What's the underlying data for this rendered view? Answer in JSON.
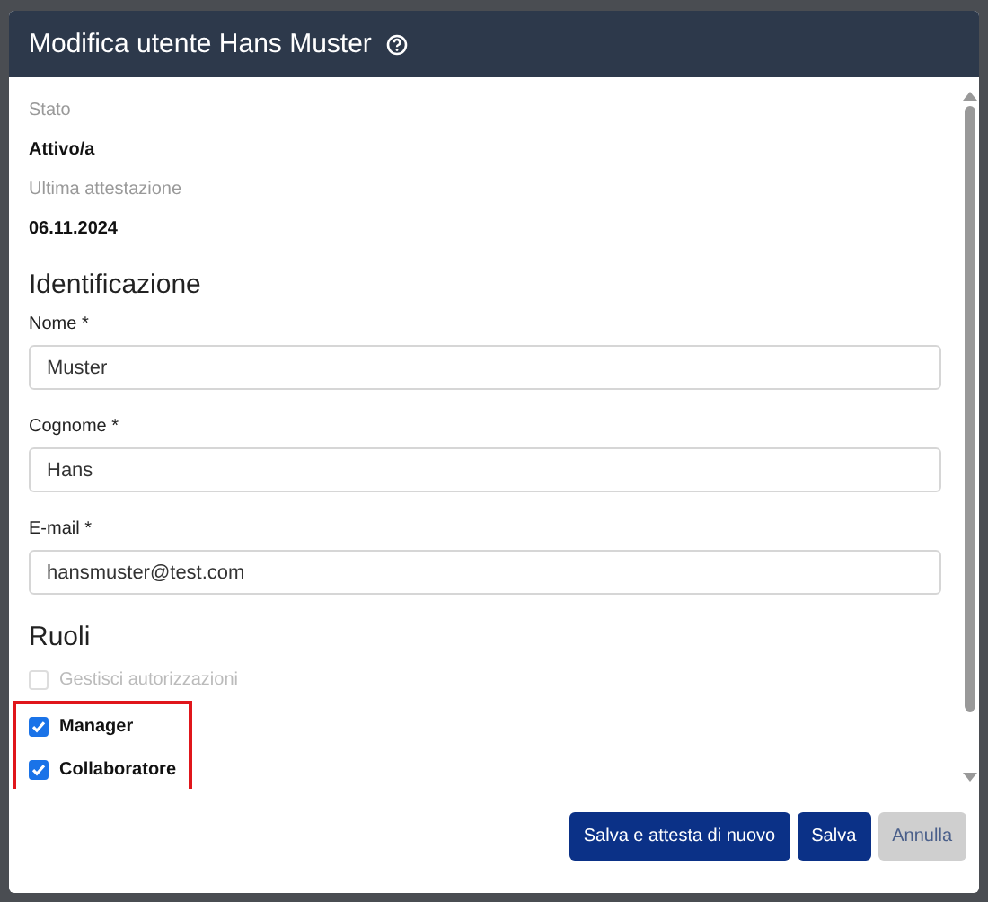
{
  "dialog": {
    "title": "Modifica utente Hans Muster"
  },
  "info": [
    {
      "label": "Stato",
      "value": "Attivo/a"
    },
    {
      "label": "Ultima attestazione",
      "value": "06.11.2024"
    }
  ],
  "identification": {
    "heading": "Identificazione",
    "fields": [
      {
        "label": "Nome *",
        "value": "Muster"
      },
      {
        "label": "Cognome *",
        "value": "Hans"
      },
      {
        "label": "E-mail *",
        "value": "hansmuster@test.com"
      }
    ]
  },
  "roles": {
    "heading": "Ruoli",
    "items": [
      {
        "label": "Gestisci autorizzazioni",
        "checked": false,
        "disabled": true,
        "highlighted": false
      },
      {
        "label": "Manager",
        "checked": true,
        "disabled": false,
        "highlighted": true
      },
      {
        "label": "Collaboratore",
        "checked": true,
        "disabled": false,
        "highlighted": true
      }
    ]
  },
  "buttons": [
    {
      "label": "Salva e attesta di nuovo",
      "kind": "primary"
    },
    {
      "label": "Salva",
      "kind": "primary"
    },
    {
      "label": "Annulla",
      "kind": "secondary"
    }
  ]
}
